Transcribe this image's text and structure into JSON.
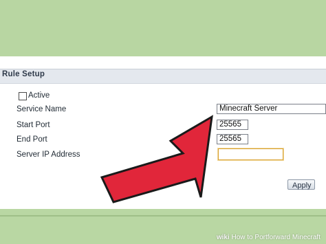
{
  "panel": {
    "title": "Rule Setup"
  },
  "form": {
    "active_label": "Active",
    "service_name_label": "Service Name",
    "service_name_value": "Minecraft Server",
    "start_port_label": "Start Port",
    "start_port_value": "25565",
    "end_port_label": "End Port",
    "end_port_value": "25565",
    "server_ip_label": "Server IP Address",
    "server_ip_value": "",
    "apply_label": "Apply"
  },
  "watermark": {
    "brand": "wiki",
    "text": "How to Portforward Minecraft"
  },
  "colors": {
    "background_green": "#b6d4a0",
    "arrow_red": "#e1263a",
    "panel_header": "#e4e8ee"
  }
}
